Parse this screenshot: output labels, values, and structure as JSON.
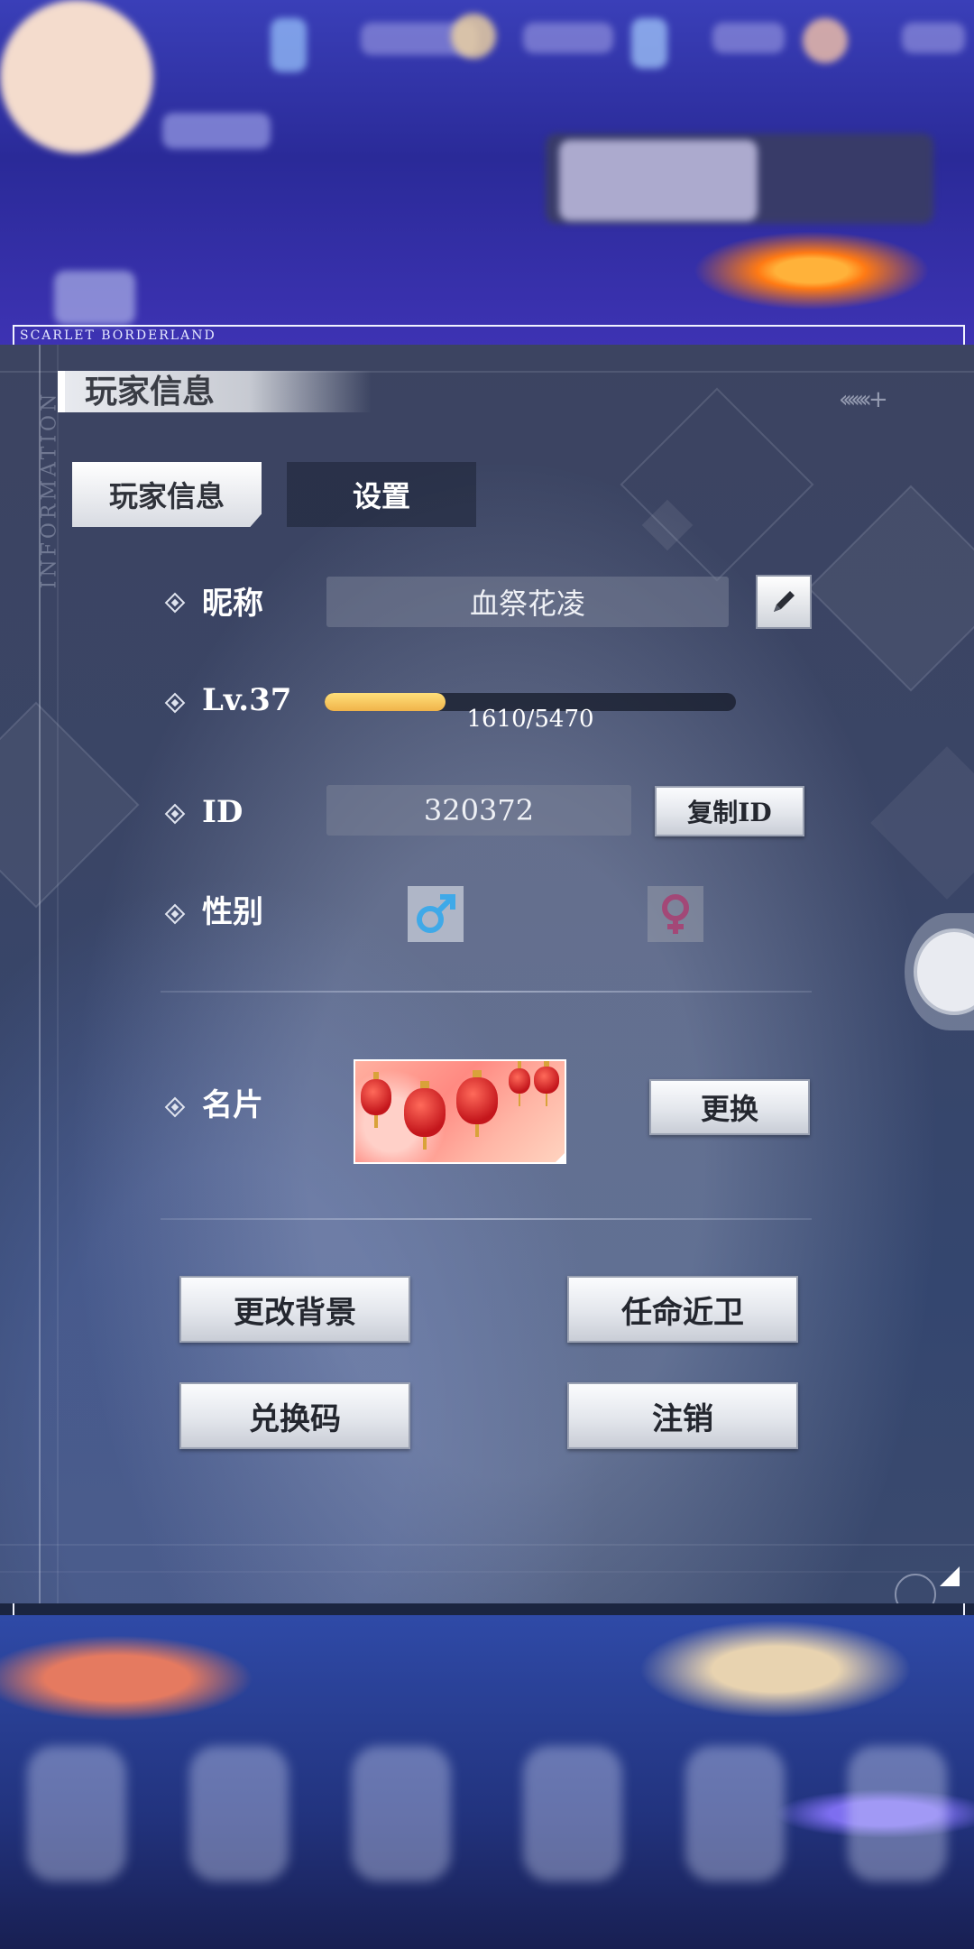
{
  "header": {
    "brand": "SCARLET BORDERLAND"
  },
  "panel": {
    "title": "玩家信息",
    "side_label": "INFORMATION",
    "tabs": [
      {
        "label": "玩家信息",
        "active": true
      },
      {
        "label": "设置",
        "active": false
      }
    ],
    "nickname": {
      "label": "昵称",
      "value": "血祭花凌",
      "edit_icon": "pencil-icon"
    },
    "level": {
      "label": "Lv.37",
      "xp_text": "1610/5470",
      "xp_fraction": 0.294
    },
    "id": {
      "label": "ID",
      "value": "320372",
      "copy_label": "复制ID"
    },
    "gender": {
      "label": "性别",
      "options": [
        "male-icon",
        "female-icon"
      ],
      "selected": "male"
    },
    "card": {
      "label": "名片",
      "change_label": "更换"
    },
    "actions": {
      "change_background": "更改背景",
      "appoint_guard": "任命近卫",
      "redeem_code": "兑换码",
      "logout": "注销"
    }
  },
  "colors": {
    "xp_fill": "#f0b34a",
    "male_icon": "#3fa9e8",
    "female_icon": "#c2185b"
  }
}
